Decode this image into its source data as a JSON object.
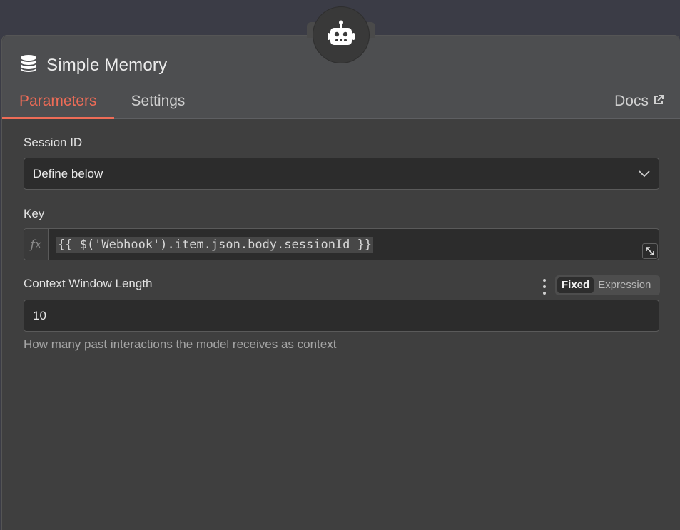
{
  "node": {
    "title": "Simple Memory",
    "header_icon": "database-icon",
    "badge_icon": "robot-icon"
  },
  "tabs": [
    {
      "label": "Parameters",
      "active": true
    },
    {
      "label": "Settings",
      "active": false
    }
  ],
  "docs_label": "Docs",
  "fields": {
    "session_id": {
      "label": "Session ID",
      "selected": "Define below"
    },
    "key": {
      "label": "Key",
      "fx_label": "fx",
      "expression": "{{ $('Webhook').item.json.body.sessionId }}"
    },
    "context_window": {
      "label": "Context Window Length",
      "value": "10",
      "hint": "How many past interactions the model receives as context",
      "mode_options": [
        "Fixed",
        "Expression"
      ],
      "mode_selected": "Fixed"
    }
  },
  "colors": {
    "accent": "#ee6c57",
    "panel_bg": "#3f3f3f",
    "header_bg": "#4d4e50",
    "input_bg": "#2c2c2c"
  }
}
